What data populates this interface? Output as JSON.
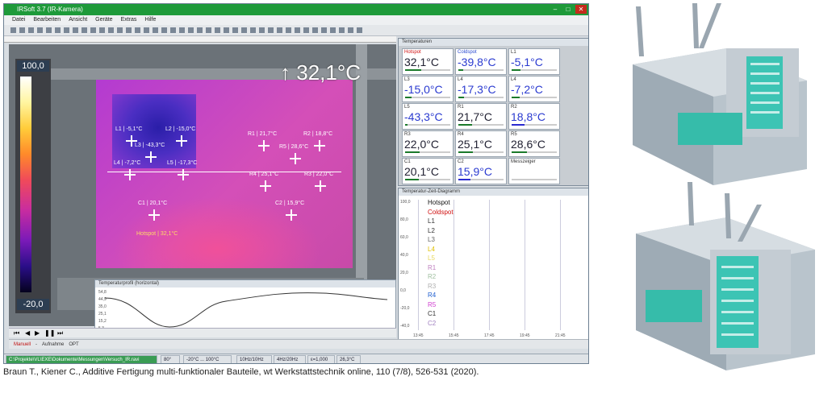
{
  "window": {
    "title": "IRSoft 3.7 (IR-Kamera)",
    "menu": [
      "Datei",
      "Bearbeiten",
      "Ansicht",
      "Geräte",
      "Extras",
      "Hilfe"
    ]
  },
  "palette": {
    "max": "100,0",
    "min": "-20,0"
  },
  "camera": {
    "hotspot_reading": "32,1°C",
    "labels": [
      "L1 | -5,1°C",
      "L2 | -15,0°C",
      "L3 | -43,3°C",
      "L4 | -7,2°C",
      "L5 | -17,3°C",
      "R1 | 21,7°C",
      "R2 | 18,8°C",
      "R3 | 22,0°C",
      "R4 | 25,1°C",
      "R5 | 28,6°C",
      "C1 | 20,1°C",
      "C2 | 15,9°C",
      "Hotspot | 32,1°C"
    ]
  },
  "profile": {
    "title": "Temperaturprofil (horizontal)",
    "ticks": [
      "54,8",
      "44,9",
      "35,0",
      "25,1",
      "15,2",
      "5,3"
    ]
  },
  "temps": {
    "title": "Temperaturen",
    "cells": [
      {
        "name": "Hotspot",
        "value": "32,1°C",
        "name_color": "#d01010",
        "value_color": "#223",
        "bar": 0.35,
        "bar_color": "#1a7a2a"
      },
      {
        "name": "Coldspot",
        "value": "-39,8°C",
        "name_color": "#2a4ad0",
        "value_color": "#2a3ad0",
        "bar": 0.1,
        "bar_color": "#1a7a2a"
      },
      {
        "name": "L1",
        "value": "-5,1°C",
        "name_color": "#333",
        "value_color": "#2a3ad0",
        "bar": 0.2,
        "bar_color": "#1a7a2a"
      },
      {
        "name": "L3",
        "value": "-15,0°C",
        "name_color": "#333",
        "value_color": "#2a3ad0",
        "bar": 0.15,
        "bar_color": "#1a7a2a"
      },
      {
        "name": "L4",
        "value": "-17,3°C",
        "name_color": "#333",
        "value_color": "#2a3ad0",
        "bar": 0.12,
        "bar_color": "#1a7a2a"
      },
      {
        "name": "L4",
        "value": "-7,2°C",
        "name_color": "#333",
        "value_color": "#2a3ad0",
        "bar": 0.18,
        "bar_color": "#1a7a2a"
      },
      {
        "name": "L5",
        "value": "-43,3°C",
        "name_color": "#333",
        "value_color": "#2a3ad0",
        "bar": 0.05,
        "bar_color": "#1a7a2a"
      },
      {
        "name": "R1",
        "value": "21,7°C",
        "name_color": "#333",
        "value_color": "#223",
        "bar": 0.3,
        "bar_color": "#1a7a2a"
      },
      {
        "name": "R2",
        "value": "18,8°C",
        "name_color": "#333",
        "value_color": "#2a3ad0",
        "bar": 0.28,
        "bar_color": "#2a2ad0"
      },
      {
        "name": "R3",
        "value": "22,0°C",
        "name_color": "#333",
        "value_color": "#223",
        "bar": 0.32,
        "bar_color": "#1a7a2a"
      },
      {
        "name": "R4",
        "value": "25,1°C",
        "name_color": "#333",
        "value_color": "#223",
        "bar": 0.33,
        "bar_color": "#1a7a2a"
      },
      {
        "name": "R5",
        "value": "28,6°C",
        "name_color": "#333",
        "value_color": "#223",
        "bar": 0.34,
        "bar_color": "#1a7a2a"
      },
      {
        "name": "C1",
        "value": "20,1°C",
        "name_color": "#333",
        "value_color": "#223",
        "bar": 0.3,
        "bar_color": "#1a7a2a"
      },
      {
        "name": "C2",
        "value": "15,9°C",
        "name_color": "#333",
        "value_color": "#2a3ad0",
        "bar": 0.26,
        "bar_color": "#2a2ad0"
      },
      {
        "name": "Messzeiger",
        "value": "",
        "name_color": "#333",
        "value_color": "#223",
        "bar": 0.0,
        "bar_color": "#1a7a2a"
      }
    ]
  },
  "diagram": {
    "title": "Temperatur-Zeit-Diagramm",
    "yticks": [
      "100,0",
      "80,0",
      "60,0",
      "40,0",
      "20,0",
      "0,0",
      "-20,0",
      "-40,0"
    ],
    "xticks": [
      "13:45",
      "15:45",
      "17:45",
      "19:45",
      "21:45"
    ],
    "legend": [
      {
        "name": "Hotspot",
        "color": "#111111"
      },
      {
        "name": "Coldspot",
        "color": "#d01010"
      },
      {
        "name": "L1",
        "color": "#333333"
      },
      {
        "name": "L2",
        "color": "#333333"
      },
      {
        "name": "L3",
        "color": "#666666"
      },
      {
        "name": "L4",
        "color": "#e0c000"
      },
      {
        "name": "L5",
        "color": "#e8d860"
      },
      {
        "name": "R1",
        "color": "#c080c0"
      },
      {
        "name": "R2",
        "color": "#a0c0a0"
      },
      {
        "name": "R3",
        "color": "#b0b0b0"
      },
      {
        "name": "R4",
        "color": "#2060d0"
      },
      {
        "name": "R5",
        "color": "#d040d0"
      },
      {
        "name": "C1",
        "color": "#333333"
      },
      {
        "name": "C2",
        "color": "#a080c0"
      }
    ]
  },
  "tabs": [
    "Manuell",
    "-",
    "Aufnahme",
    "OPT"
  ],
  "status": {
    "path": "C:\\Projekte\\VL\\EXE\\Dokumente\\Messungen\\Versuch_IR.ravi",
    "pos": "80°",
    "range": "-20°C ... 100°C",
    "framerate": "10Hz/10Hz",
    "a": "4Hz/20Hz",
    "emissivity": "ε=1,000",
    "temp": "26,3°C"
  },
  "citation": "Braun T., Kiener C., Additive Fertigung multi-funktionaler Bauteile, wt Werkstattstechnik online, 110 (7/8), 526-531 (2020)."
}
